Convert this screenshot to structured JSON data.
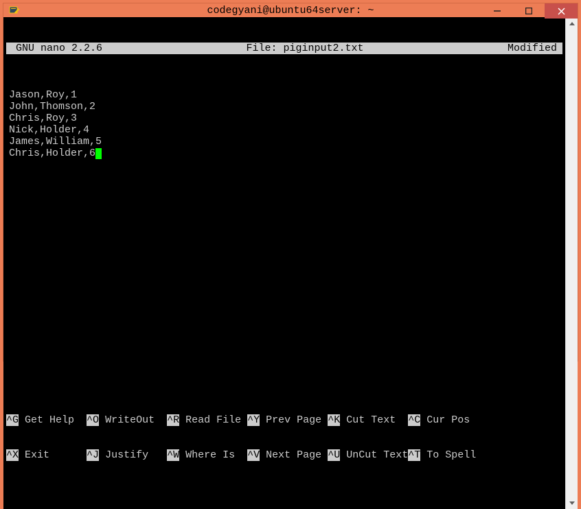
{
  "window": {
    "title": "codegyani@ubuntu64server: ~"
  },
  "nano": {
    "app_label": "GNU nano 2.2.6",
    "file_label": "File: piginput2.txt",
    "status": "Modified"
  },
  "content_lines": [
    "Jason,Roy,1",
    "John,Thomson,2",
    "Chris,Roy,3",
    "Nick,Holder,4",
    "James,William,5",
    "Chris,Holder,6"
  ],
  "shortcuts_row1": [
    {
      "key": "^G",
      "label": " Get Help  "
    },
    {
      "key": "^O",
      "label": " WriteOut  "
    },
    {
      "key": "^R",
      "label": " Read File "
    },
    {
      "key": "^Y",
      "label": " Prev Page "
    },
    {
      "key": "^K",
      "label": " Cut Text  "
    },
    {
      "key": "^C",
      "label": " Cur Pos"
    }
  ],
  "shortcuts_row2": [
    {
      "key": "^X",
      "label": " Exit      "
    },
    {
      "key": "^J",
      "label": " Justify   "
    },
    {
      "key": "^W",
      "label": " Where Is  "
    },
    {
      "key": "^V",
      "label": " Next Page "
    },
    {
      "key": "^U",
      "label": " UnCut Text"
    },
    {
      "key": "^T",
      "label": " To Spell"
    }
  ]
}
